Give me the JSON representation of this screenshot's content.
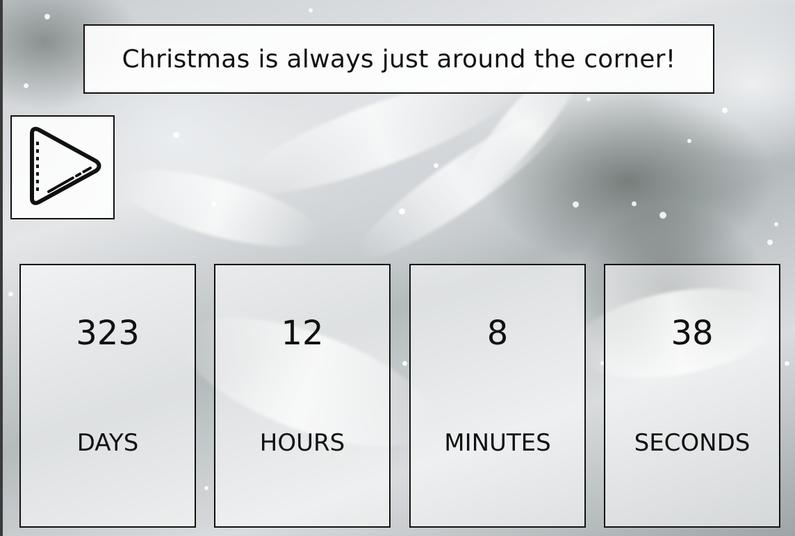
{
  "banner": {
    "text": "Christmas is always just around the corner!"
  },
  "player": {
    "icon": "play-icon"
  },
  "countdown": {
    "days": {
      "value": "323",
      "label": "DAYS"
    },
    "hours": {
      "value": "12",
      "label": "HOURS"
    },
    "minutes": {
      "value": "8",
      "label": "MINUTES"
    },
    "seconds": {
      "value": "38",
      "label": "SECONDS"
    }
  },
  "colors": {
    "text": "#111111",
    "border": "#111111"
  }
}
